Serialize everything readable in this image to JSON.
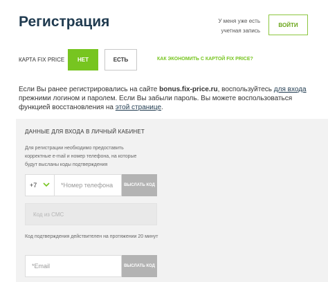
{
  "header": {
    "title": "Регистрация",
    "login_prompt": "У меня уже есть учетная запись",
    "login_button": "ВОЙТИ"
  },
  "card_question": {
    "label": "КАРТА FIX PRICE",
    "no_button": "НЕТ",
    "yes_button": "ЕСТЬ",
    "save_link": "КАК ЭКОНОМИТЬ С КАРТОЙ FIX PRICE?"
  },
  "info": {
    "part1": "Если Вы ранее регистрировались на сайте ",
    "site": "bonus.fix-price.ru",
    "part2": ", воспользуйтесь ",
    "login_link": "для входа",
    "part3": " прежними логином и паролем. Если Вы забыли пароль. Вы можете воспользоваться функцией восстановления на ",
    "restore_link": "этой странице",
    "part4": "."
  },
  "form": {
    "title": "ДАННЫЕ ДЛЯ ВХОДА В ЛИЧНЫЙ КАБИНЕТ",
    "hint": "Для регистрации необходимо предоставить корректные e-mail и номер телефона, на которые будут высланы коды подтверждения",
    "phone_code": "+7",
    "phone_placeholder": "*Номер телефона",
    "send_code_label": "ВЫСЛАТЬ КОД",
    "sms_placeholder": "Код из СМС",
    "validity_note": "Код подтверждения действителен на протяжении 20 минут",
    "email_placeholder": "*Email",
    "send_code_label_2": "ВЫСЛАТЬ КОД"
  },
  "colors": {
    "accent_green": "#77c520",
    "title_blue": "#1f3a4f",
    "panel_bg": "#f2f2f2",
    "disabled_button": "#b3b3b3"
  },
  "icons": {
    "phone_code_dropdown": "chevron-down-icon"
  }
}
